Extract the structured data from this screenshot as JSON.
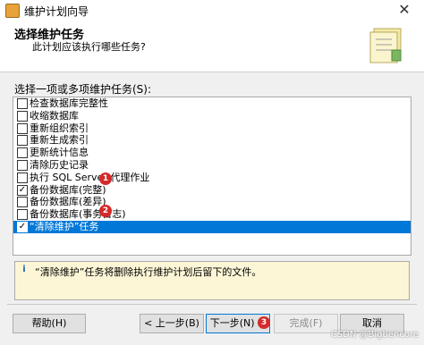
{
  "window": {
    "title": "维护计划向导",
    "close_glyph": "✕"
  },
  "header": {
    "title": "选择维护任务",
    "subtitle": "此计划应该执行哪些任务?"
  },
  "tasks": {
    "label": "选择一项或多项维护任务(S):",
    "items": [
      {
        "label": "检查数据库完整性",
        "checked": false,
        "mark": ""
      },
      {
        "label": "收缩数据库",
        "checked": false,
        "mark": ""
      },
      {
        "label": "重新组织索引",
        "checked": false,
        "mark": ""
      },
      {
        "label": "重新生成索引",
        "checked": false,
        "mark": ""
      },
      {
        "label": "更新统计信息",
        "checked": false,
        "mark": ""
      },
      {
        "label": "清除历史记录",
        "checked": false,
        "mark": ""
      },
      {
        "label": "执行 SQL Server 代理作业",
        "checked": false,
        "mark": ""
      },
      {
        "label": "备份数据库(完整)",
        "checked": true,
        "mark": "✓"
      },
      {
        "label": "备份数据库(差异)",
        "checked": false,
        "mark": ""
      },
      {
        "label": "备份数据库(事务日志)",
        "checked": false,
        "mark": ""
      },
      {
        "label": "“清除维护”任务",
        "checked": true,
        "mark": "✓",
        "selected": true
      }
    ]
  },
  "annotations": [
    "1",
    "2",
    "3"
  ],
  "description": {
    "icon": "i",
    "text": "“清除维护”任务将删除执行维护计划后留下的文件。"
  },
  "buttons": {
    "help": "帮助(H)",
    "back": "< 上一步(B)",
    "next": "下一步(N) >",
    "finish": "完成(F)",
    "cancel": "取消"
  },
  "watermark": "CSDN @Bigbencore",
  "colors": {
    "selection": "#0078d7",
    "annotation_badge": "#d42a2a",
    "description_bg": "#fdf6d6"
  }
}
